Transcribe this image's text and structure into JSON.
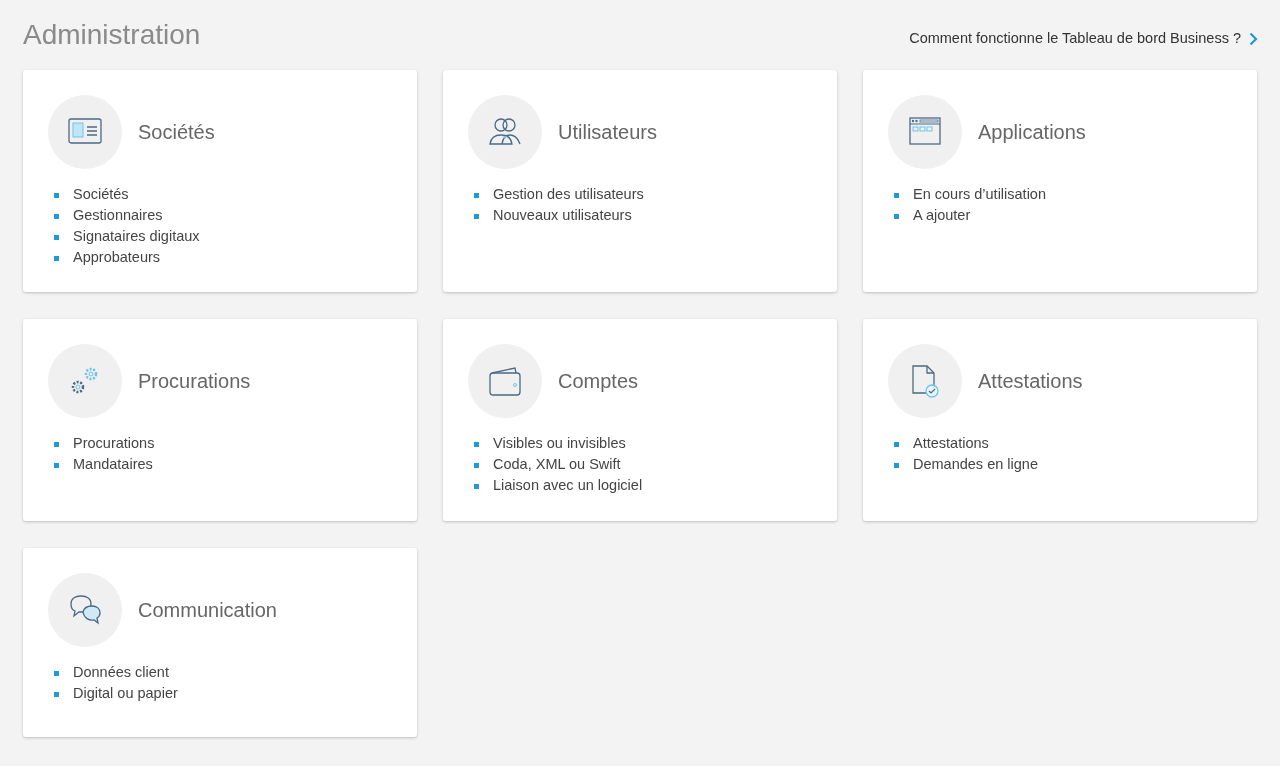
{
  "page": {
    "title": "Administration",
    "help_link": "Comment fonctionne le Tableau de bord Business ?"
  },
  "cards": [
    {
      "kind": "companies",
      "title": "Sociétés",
      "links": [
        "Sociétés",
        "Gestionnaires",
        "Signataires digitaux",
        "Approbateurs"
      ]
    },
    {
      "kind": "users",
      "title": "Utilisateurs",
      "links": [
        "Gestion des utilisateurs",
        "Nouveaux utilisateurs"
      ]
    },
    {
      "kind": "applications",
      "title": "Applications",
      "links": [
        "En cours d’utilisation",
        "A ajouter"
      ]
    },
    {
      "kind": "proxies",
      "title": "Procurations",
      "links": [
        "Procurations",
        "Mandataires"
      ]
    },
    {
      "kind": "accounts",
      "title": "Comptes",
      "links": [
        "Visibles ou invisibles",
        "Coda, XML ou Swift",
        "Liaison avec un logiciel"
      ]
    },
    {
      "kind": "certificates",
      "title": "Attestations",
      "links": [
        "Attestations",
        "Demandes en ligne"
      ]
    },
    {
      "kind": "communication",
      "title": "Communication",
      "links": [
        "Données client",
        "Digital ou papier"
      ]
    }
  ]
}
